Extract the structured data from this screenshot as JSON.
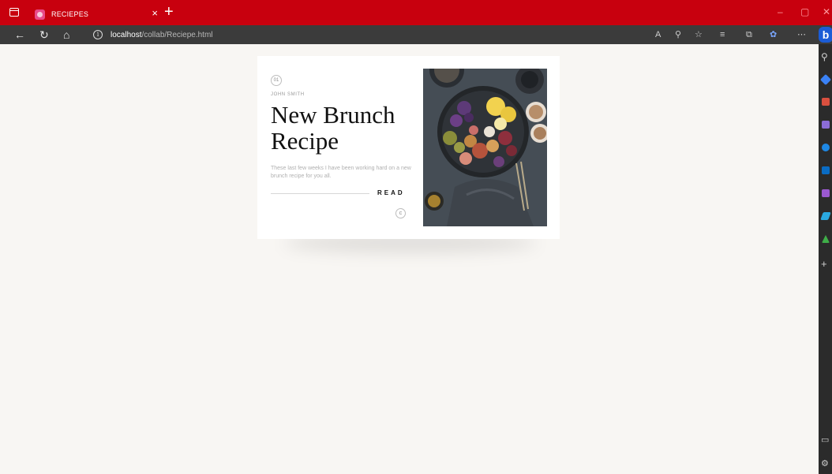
{
  "browser": {
    "tab_title": "RECIEPES",
    "tab_close": "×",
    "new_tab": "+",
    "url_host": "localhost",
    "url_path": "/collab/Reciepe.html",
    "window_minimize": "–",
    "window_restore": "▢",
    "window_close": "✕"
  },
  "card": {
    "number": "01",
    "author": "JOHN SMITH",
    "title": "New Brunch Recipe",
    "description": "These last few weeks I have been working hard on a new brunch recipe for you all.",
    "read_label": "READ",
    "copyright_symbol": "c"
  },
  "colors": {
    "titlebar": "#c8000e",
    "page_background": "#f8f6f3",
    "addressbar": "#3b3b3b"
  }
}
